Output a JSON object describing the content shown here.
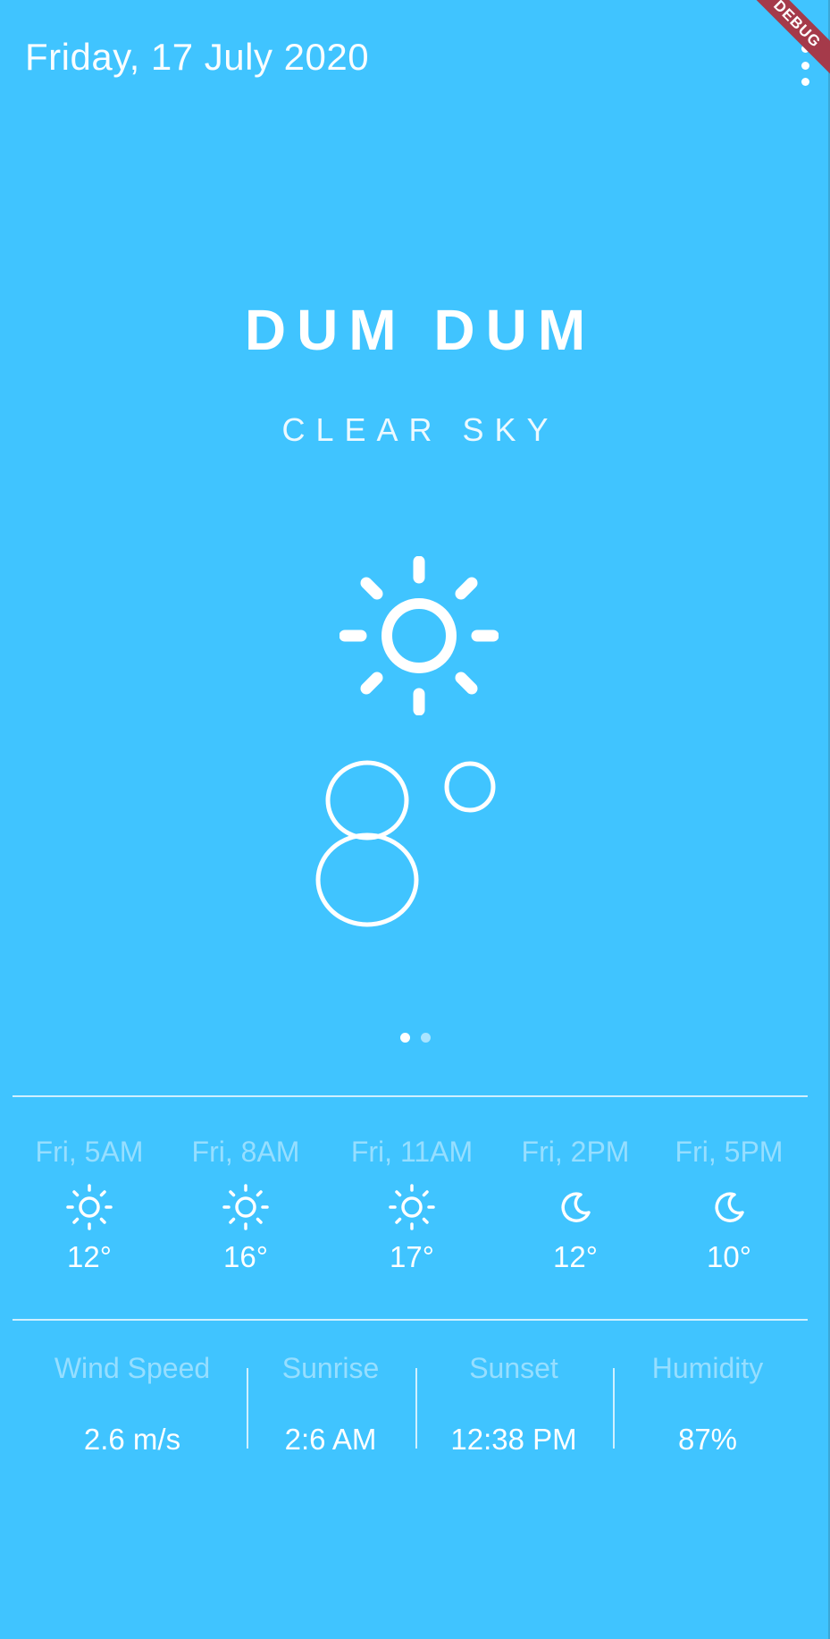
{
  "header": {
    "date": "Friday, 17 July 2020",
    "menu_icon": "more-vert-icon",
    "debug_banner": "DEBUG"
  },
  "location": {
    "city": "DUM DUM",
    "condition": "CLEAR SKY",
    "icon": "sun-icon",
    "temperature": "8°"
  },
  "pager": {
    "count": 2,
    "active_index": 0
  },
  "hourly": [
    {
      "label": "Fri, 5AM",
      "icon": "sun-icon",
      "temp": "12°"
    },
    {
      "label": "Fri, 8AM",
      "icon": "sun-icon",
      "temp": "16°"
    },
    {
      "label": "Fri, 11AM",
      "icon": "sun-icon",
      "temp": "17°"
    },
    {
      "label": "Fri, 2PM",
      "icon": "moon-icon",
      "temp": "12°"
    },
    {
      "label": "Fri, 5PM",
      "icon": "moon-icon",
      "temp": "10°"
    }
  ],
  "stats": [
    {
      "label": "Wind Speed",
      "value": "2.6 m/s"
    },
    {
      "label": "Sunrise",
      "value": "2:6 AM"
    },
    {
      "label": "Sunset",
      "value": "12:38 PM"
    },
    {
      "label": "Humidity",
      "value": "87%"
    }
  ],
  "colors": {
    "background": "#40c4ff",
    "foreground": "#ffffff",
    "debug_banner": "#a53a4a"
  }
}
